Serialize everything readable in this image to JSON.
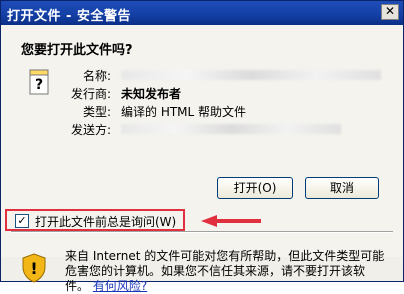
{
  "window": {
    "title": "打开文件 - 安全警告",
    "close_label": "✕"
  },
  "question": "您要打开此文件吗?",
  "fields": [
    {
      "label": "名称:",
      "value": ""
    },
    {
      "label": "发行商:",
      "value": "未知发布者"
    },
    {
      "label": "类型:",
      "value": "编译的 HTML 帮助文件"
    },
    {
      "label": "发送方:",
      "value": ""
    }
  ],
  "buttons": {
    "open": "打开(O)",
    "cancel": "取消"
  },
  "checkbox": {
    "label": "打开此文件前总是询问(W)",
    "checked": true,
    "mark": "✓"
  },
  "warning": {
    "text": "来自 Internet 的文件可能对您有所帮助，但此文件类型可能危害您的计算机。如果您不信任其来源，请不要打开该软件。",
    "link": "有何风险?"
  },
  "colors": {
    "highlight": "#e03040",
    "link": "#1a37b8",
    "title_bar": "#1440a6"
  }
}
